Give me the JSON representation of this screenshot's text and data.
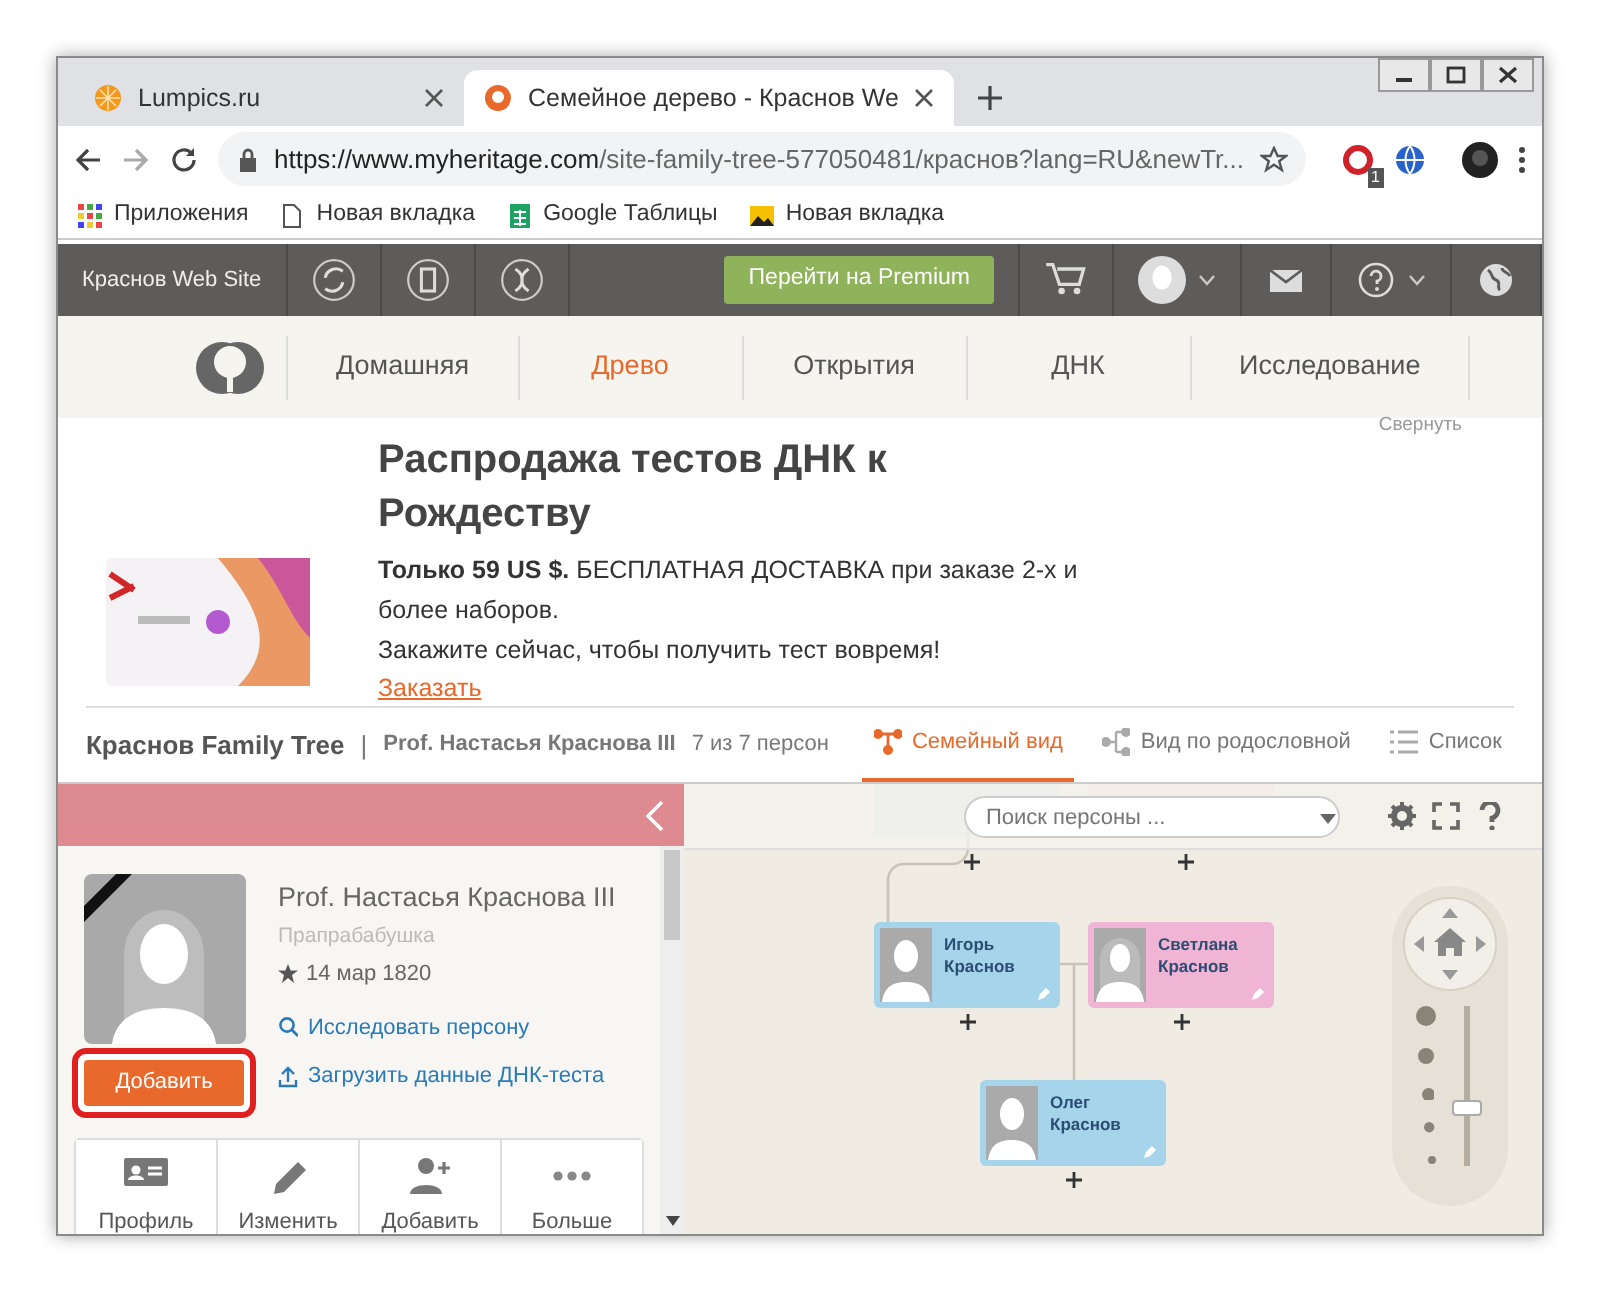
{
  "browser": {
    "tabs": [
      {
        "title": "Lumpics.ru",
        "kind": "lumpics",
        "selected": false
      },
      {
        "title": "Семейное дерево - Краснов We",
        "kind": "myheritage",
        "selected": true
      }
    ],
    "url_host": "https://www.myheritage.com",
    "url_path": "/site-family-tree-577050481/краснов?lang=RU&newTr...",
    "extension_badge": "1",
    "bookmarks": [
      {
        "label": "Приложения",
        "kind": "apps"
      },
      {
        "label": "Новая вкладка",
        "kind": "page"
      },
      {
        "label": "Google Таблицы",
        "kind": "sheets"
      },
      {
        "label": "Новая вкладка",
        "kind": "image"
      }
    ]
  },
  "site_bar": {
    "site_name": "Краснов Web Site",
    "premium_button": "Перейти на Premium"
  },
  "nav": {
    "items": [
      {
        "label": "Домашняя",
        "selected": false
      },
      {
        "label": "Древо",
        "selected": true
      },
      {
        "label": "Открытия",
        "selected": false
      },
      {
        "label": "ДНК",
        "selected": false
      },
      {
        "label": "Исследование",
        "selected": false
      }
    ]
  },
  "banner": {
    "collapse": "Свернуть",
    "title": "Распродажа тестов ДНК к Рождеству",
    "text": "**Только 59 US $.** БЕСПЛАТНАЯ ДОСТАВКА при заказе 2-х и более наборов.",
    "text2": "Закажите сейчас, чтобы получить тест вовремя!",
    "link": "Заказать"
  },
  "tree_header": {
    "tree_name": "Краснов Family Tree",
    "separator": "|",
    "person": "Prof. Настасья Краснова III",
    "count": "7 из 7 персон",
    "views": [
      {
        "label": "Семейный вид",
        "kind": "family",
        "selected": true
      },
      {
        "label": "Вид по родословной",
        "kind": "pedigree",
        "selected": false
      },
      {
        "label": "Список",
        "kind": "list",
        "selected": false
      }
    ]
  },
  "panel": {
    "name": "Prof. Настасья Краснова III",
    "relation": "Прапрабабушка",
    "birth": "14 мар 1820",
    "deceased": true,
    "add_photo_button": "Добавить",
    "highlighted": true,
    "links": [
      {
        "label": "Исследовать персону",
        "kind": "search"
      },
      {
        "label": "Загрузить данные ДНК-теста",
        "kind": "upload"
      }
    ],
    "actions": [
      {
        "label": "Профиль",
        "kind": "profile"
      },
      {
        "label": "Изменить",
        "kind": "edit"
      },
      {
        "label": "Добавить",
        "kind": "add"
      },
      {
        "label": "Больше",
        "kind": "more"
      }
    ]
  },
  "canvas": {
    "search": {
      "placeholder": "Поиск персоны ..."
    },
    "people": [
      {
        "name": "Игорь Краснов",
        "kind": "male"
      },
      {
        "name": "Светлана Краснов",
        "kind": "female"
      },
      {
        "name": "Олег Краснов",
        "kind": "male"
      }
    ],
    "zoom": {
      "level": 0.35
    }
  }
}
